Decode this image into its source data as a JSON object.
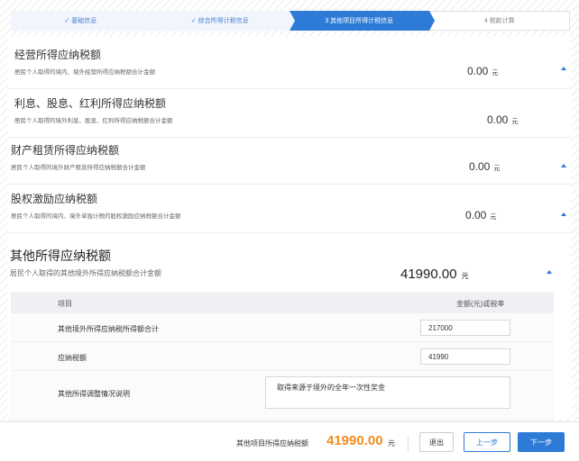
{
  "steps": [
    {
      "label": "✓ 基础信息"
    },
    {
      "label": "✓ 综合所得计税信息"
    },
    {
      "label": "3  其他项目所得计税信息"
    },
    {
      "label": "4  税款计算"
    }
  ],
  "sections": [
    {
      "title": "经营所得应纳税额",
      "desc": "居民个人取得的境内、境外经营所得应纳税额合计金额",
      "amount": "0.00",
      "unit": "元"
    },
    {
      "title": "利息、股息、红利所得应纳税额",
      "desc": "居民个人取得的境外利息、股息、红利所得应纳税额合计金额",
      "amount": "0.00",
      "unit": "元"
    },
    {
      "title": "财产租赁所得应纳税额",
      "desc": "居民个人取得的境外财产租赁所得应纳税额合计金额",
      "amount": "0.00",
      "unit": "元"
    },
    {
      "title": "股权激励应纳税额",
      "desc": "居民个人取得的境内、境外单独计税的股权激励应纳税额合计金额",
      "amount": "0.00",
      "unit": "元"
    }
  ],
  "other": {
    "title": "其他所得应纳税额",
    "desc": "居民个人取得的其他境外所得应纳税额合计金额",
    "amount": "41990.00",
    "unit": "元",
    "table": {
      "col_item": "项目",
      "col_amount": "金额(元)或税率",
      "rows": [
        {
          "label": "其他境外所得应纳税所得额合计",
          "value": "217000"
        },
        {
          "label": "应纳税额",
          "value": "41990"
        },
        {
          "label": "其他所得调整情况说明",
          "value": "取得来源于境外的全年一次性奖金"
        }
      ]
    }
  },
  "footer": {
    "total_label": "其他项目所得应纳税额",
    "total_amount": "41990.00",
    "total_unit": "元",
    "exit": "退出",
    "prev": "上一步",
    "next": "下一步"
  },
  "colors": {
    "accent": "#2d7bd6",
    "amount": "#f08d1e"
  }
}
